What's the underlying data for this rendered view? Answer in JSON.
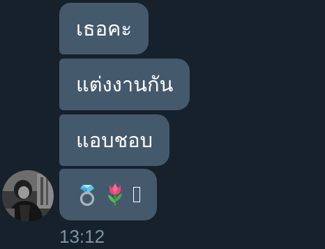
{
  "messages": [
    {
      "text": "เธอคะ"
    },
    {
      "text": "แต่งงานกัน"
    },
    {
      "text": "แอบชอบ"
    }
  ],
  "emoji_message": {
    "emojis": [
      "ring-emoji",
      "tulip-emoji",
      "unknown-glyph"
    ]
  },
  "timestamp": "13:12",
  "colors": {
    "background": "#17212b",
    "bubble": "#45596d",
    "text": "#ffffff",
    "timestamp": "#7f93a5"
  }
}
